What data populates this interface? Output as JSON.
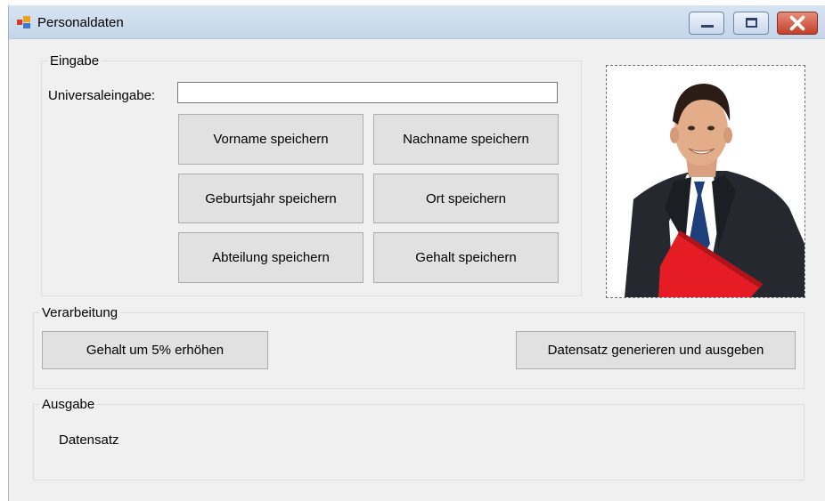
{
  "window": {
    "title": "Personaldaten"
  },
  "eingabe": {
    "group_label": "Eingabe",
    "universal_label": "Universaleingabe:",
    "universal_value": "",
    "buttons": {
      "vorname": "Vorname speichern",
      "nachname": "Nachname speichern",
      "geburtsjahr": "Geburtsjahr speichern",
      "ort": "Ort speichern",
      "abteilung": "Abteilung speichern",
      "gehalt": "Gehalt speichern"
    }
  },
  "verarbeitung": {
    "group_label": "Verarbeitung",
    "buttons": {
      "gehalt_erhoehen": "Gehalt um 5% erhöhen",
      "datensatz_generieren": "Datensatz generieren und ausgeben"
    }
  },
  "ausgabe": {
    "group_label": "Ausgabe",
    "output_text": "Datensatz"
  },
  "colors": {
    "window_bg": "#f0f0f0",
    "button_bg": "#e1e1e1",
    "close_button": "#c3402a"
  },
  "icons": {
    "app": "windows-form-icon",
    "minimize": "minimize-icon",
    "maximize": "maximize-icon",
    "close": "close-icon"
  }
}
